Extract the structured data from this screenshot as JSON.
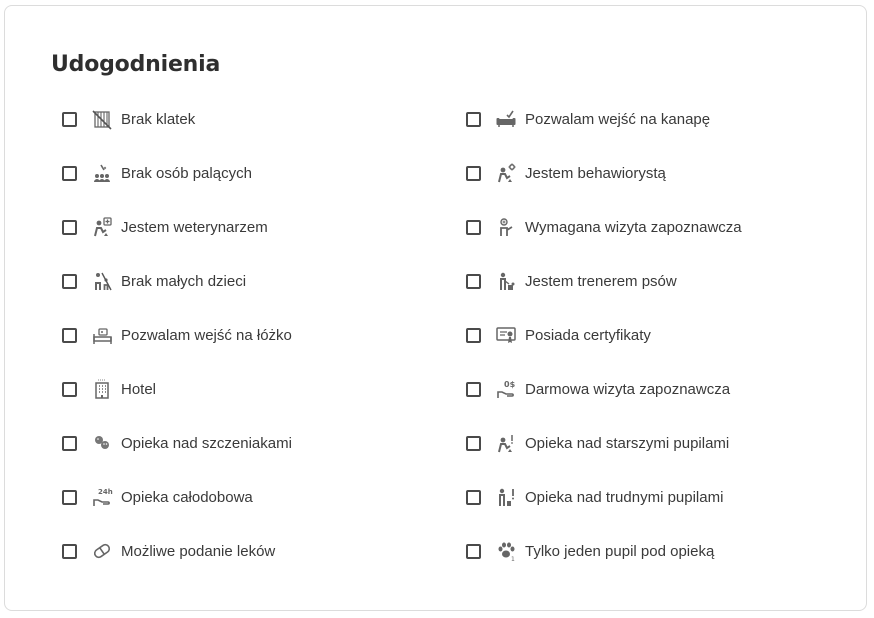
{
  "section": {
    "title": "Udogodnienia"
  },
  "left": [
    {
      "label": "Brak klatek",
      "icon": "no-cage-icon",
      "checked": false
    },
    {
      "label": "Brak osób palących",
      "icon": "no-smoking-people-icon",
      "checked": false
    },
    {
      "label": "Jestem weterynarzem",
      "icon": "veterinarian-icon",
      "checked": false
    },
    {
      "label": "Brak małych dzieci",
      "icon": "no-small-children-icon",
      "checked": false
    },
    {
      "label": "Pozwalam wejść na łóżko",
      "icon": "bed-icon",
      "checked": false
    },
    {
      "label": "Hotel",
      "icon": "hotel-building-icon",
      "checked": false
    },
    {
      "label": "Opieka nad szczeniakami",
      "icon": "puppies-icon",
      "checked": false
    },
    {
      "label": "Opieka całodobowa",
      "icon": "24h-care-icon",
      "checked": false
    },
    {
      "label": "Możliwe podanie leków",
      "icon": "pill-icon",
      "checked": false
    }
  ],
  "right": [
    {
      "label": "Pozwalam wejść na kanapę",
      "icon": "sofa-icon",
      "checked": false
    },
    {
      "label": "Jestem behawiorystą",
      "icon": "behaviorist-icon",
      "checked": false
    },
    {
      "label": "Wymagana wizyta zapoznawcza",
      "icon": "meet-greet-required-icon",
      "checked": false
    },
    {
      "label": "Jestem trenerem psów",
      "icon": "dog-trainer-icon",
      "checked": false
    },
    {
      "label": "Posiada certyfikaty",
      "icon": "certificate-icon",
      "checked": false
    },
    {
      "label": "Darmowa wizyta zapoznawcza",
      "icon": "free-visit-icon",
      "checked": false
    },
    {
      "label": "Opieka nad starszymi pupilami",
      "icon": "senior-pets-icon",
      "checked": false
    },
    {
      "label": "Opieka nad trudnymi pupilami",
      "icon": "difficult-pets-icon",
      "checked": false
    },
    {
      "label": "Tylko jeden pupil pod opieką",
      "icon": "single-pet-icon",
      "checked": false
    }
  ]
}
